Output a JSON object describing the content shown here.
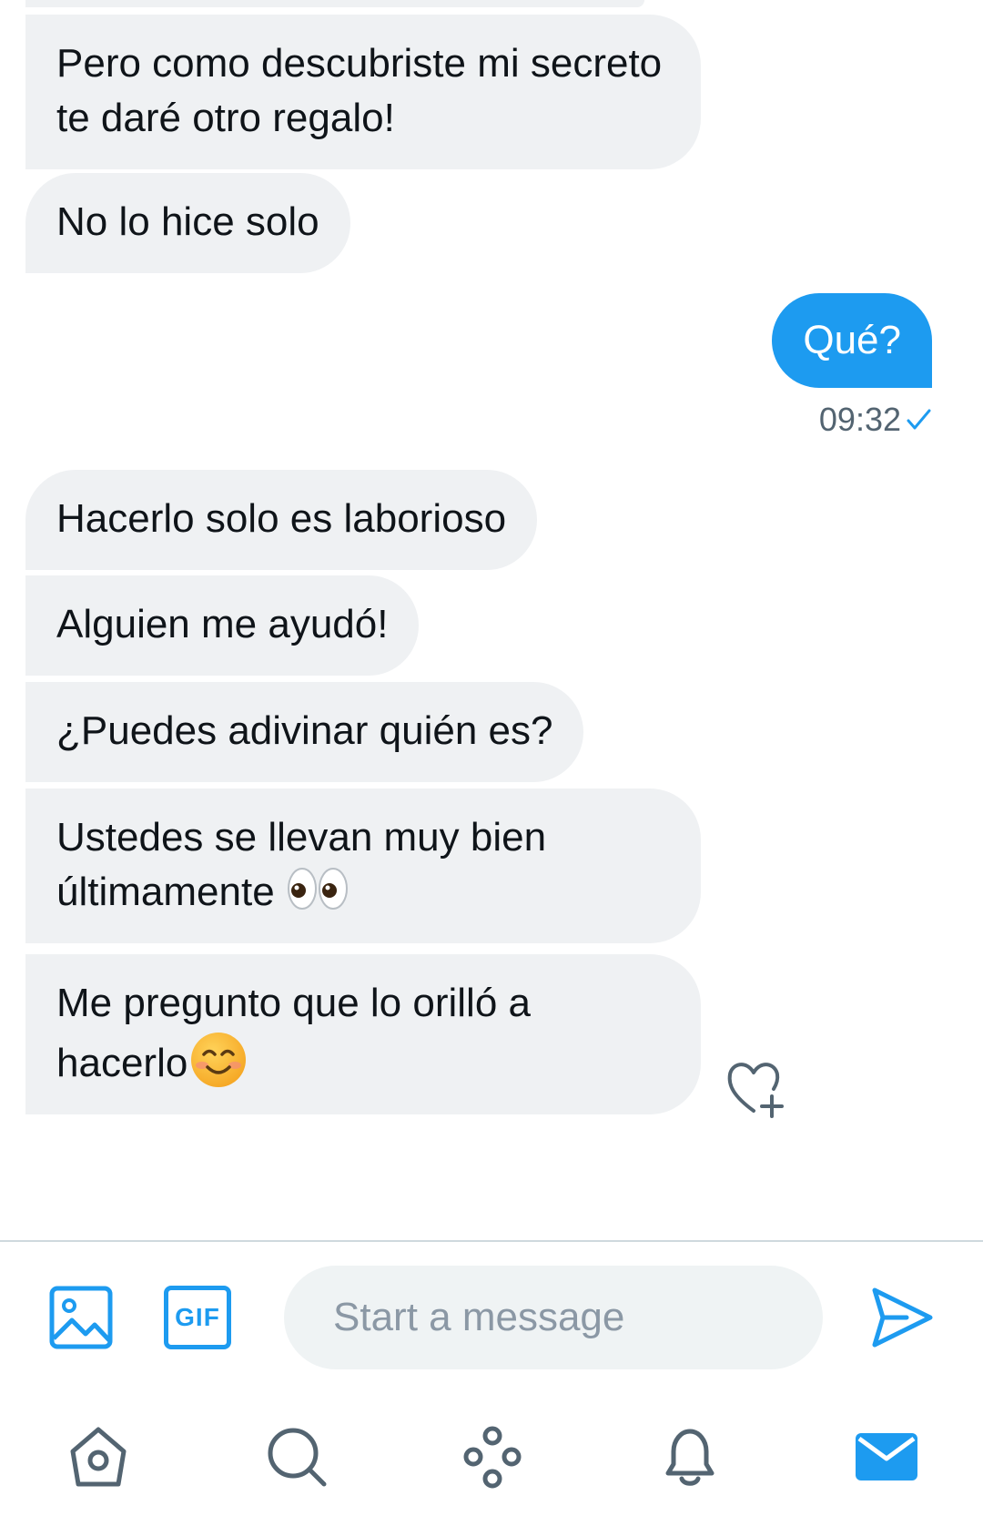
{
  "messages": [
    {
      "id": "m1",
      "direction": "in",
      "text": "Pero como descubriste mi secreto te daré otro regalo!"
    },
    {
      "id": "m2",
      "direction": "in",
      "text": "No lo hice solo"
    },
    {
      "id": "m3",
      "direction": "out",
      "text": "Qué?",
      "time": "09:32",
      "status": "sent-check"
    },
    {
      "id": "m4",
      "direction": "in",
      "text": "Hacerlo solo es laborioso"
    },
    {
      "id": "m5",
      "direction": "in",
      "text": "Alguien me ayudó!"
    },
    {
      "id": "m6",
      "direction": "in",
      "text": "¿Puedes adivinar quién es?"
    },
    {
      "id": "m7",
      "direction": "in",
      "line1": "Ustedes se llevan muy bien",
      "line2": "últimamente",
      "emoji": "eyes-emoji"
    },
    {
      "id": "m8",
      "direction": "in",
      "line1": "Me pregunto que lo orilló a",
      "line2": "hacerlo",
      "emoji": "smiling-face-emoji"
    }
  ],
  "composer": {
    "placeholder": "Start a message",
    "gif_label": "GIF",
    "icons": [
      "image-icon",
      "gif-icon",
      "send-icon"
    ]
  },
  "reaction_icon": "heart-plus-icon",
  "bottom_nav": [
    {
      "name": "home-icon",
      "active": false
    },
    {
      "name": "search-icon",
      "active": false
    },
    {
      "name": "spaces-icon",
      "active": false
    },
    {
      "name": "notifications-icon",
      "active": false
    },
    {
      "name": "messages-icon",
      "active": true
    }
  ],
  "colors": {
    "accent": "#1d9bf0",
    "bubble_in": "#eff1f3",
    "text_primary": "#0f1419",
    "text_secondary": "#536471",
    "icon_gray": "#536471"
  }
}
